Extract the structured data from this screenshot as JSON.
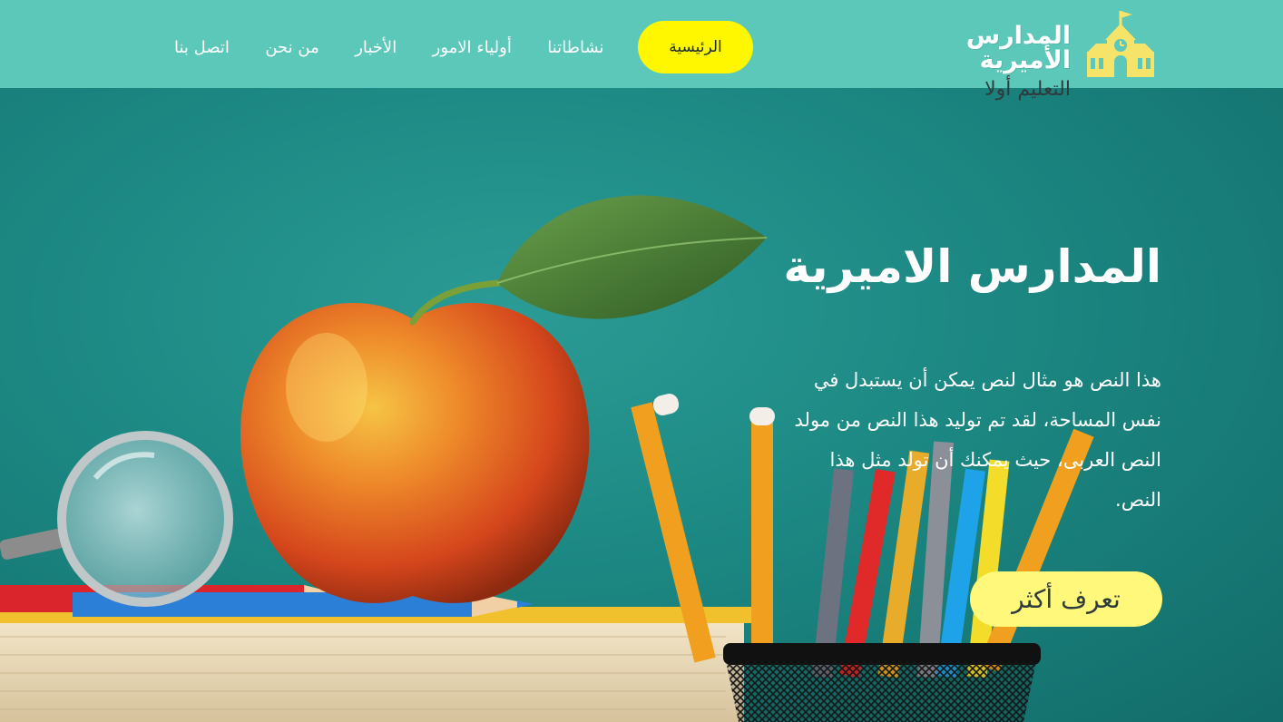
{
  "header": {
    "brand": {
      "name": "المدارس الأميرية",
      "tagline": "التعليم أولا",
      "icon": "school-building-icon"
    },
    "nav": [
      {
        "label": "الرئيسية",
        "active": true
      },
      {
        "label": "نشاطاتنا",
        "active": false
      },
      {
        "label": "أولياء الامور",
        "active": false
      },
      {
        "label": "الأخبار",
        "active": false
      },
      {
        "label": "من نحن",
        "active": false
      },
      {
        "label": "اتصل بنا",
        "active": false
      }
    ]
  },
  "hero": {
    "title": "المدارس الاميرية",
    "text": "هذا النص هو مثال لنص يمكن أن يستبدل في نفس المساحة، لقد تم توليد هذا النص من مولد النص العربى، حيث يمكنك أن تولد مثل هذا النص.",
    "cta_label": "تعرف أكثر"
  },
  "colors": {
    "header_bg": "#5cc8b9",
    "active_nav_bg": "#fff700",
    "cta_bg": "#fff87a",
    "hero_bg": "#1d8a85"
  }
}
